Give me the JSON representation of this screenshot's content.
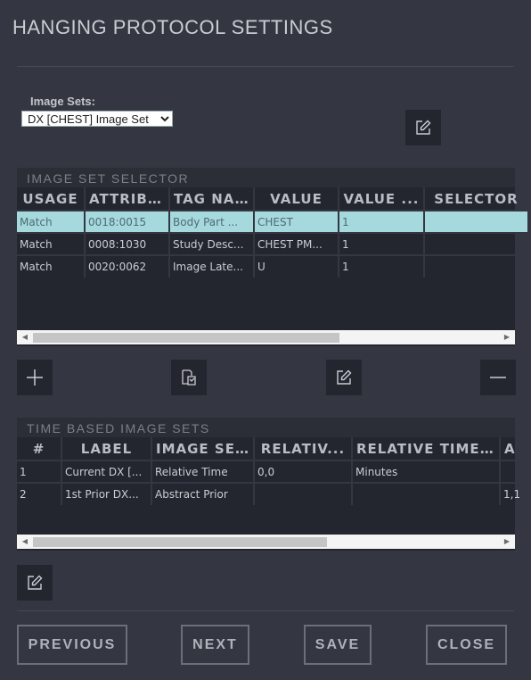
{
  "title": "HANGING PROTOCOL SETTINGS",
  "image_sets": {
    "label": "Image Sets:",
    "selected": "DX [CHEST] Image Set"
  },
  "selector_panel": {
    "title": "IMAGE SET SELECTOR",
    "columns": [
      "USAGE",
      "ATTRIB...",
      "TAG NA...",
      "VALUE",
      "VALUE ...",
      "SELECTOR"
    ],
    "rows": [
      [
        "Match",
        "0018:0015",
        "Body Part ...",
        "CHEST",
        "1",
        ""
      ],
      [
        "Match",
        "0008:1030",
        "Study Desc...",
        "CHEST PM...",
        "1",
        ""
      ],
      [
        "Match",
        "0020:0062",
        "Image Late...",
        "U",
        "1",
        ""
      ]
    ]
  },
  "time_panel": {
    "title": "TIME BASED IMAGE SETS",
    "columns": [
      "#",
      "LABEL",
      "IMAGE SE...",
      "RELATIV...",
      "RELATIVE TIME...",
      "A"
    ],
    "rows": [
      [
        "1",
        "Current DX [...",
        "Relative Time",
        "0,0",
        "Minutes",
        ""
      ],
      [
        "2",
        "1st Prior DX...",
        "Abstract Prior",
        "",
        "",
        "1,1"
      ]
    ]
  },
  "buttons": {
    "previous": "PREVIOUS",
    "next": "NEXT",
    "save": "SAVE",
    "close": "CLOSE"
  },
  "icons": {
    "edit": "edit-icon",
    "add": "plus-icon",
    "copy": "copy-icon",
    "remove": "minus-icon"
  }
}
